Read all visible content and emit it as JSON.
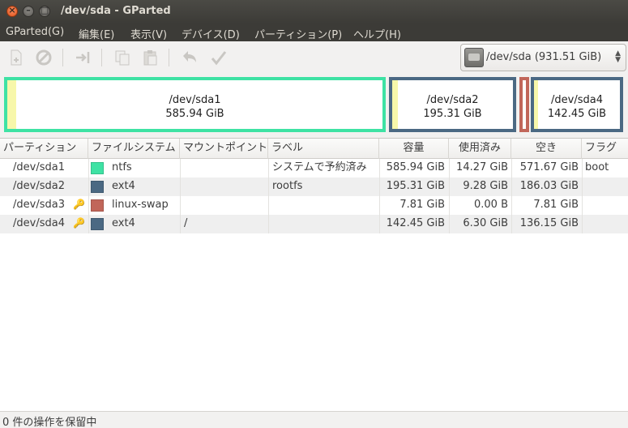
{
  "window": {
    "title": "/dev/sda - GParted"
  },
  "menu": [
    "GParted(G)",
    "編集(E)",
    "表示(V)",
    "デバイス(D)",
    "パーティション(P)",
    "ヘルプ(H)"
  ],
  "toolbar": {
    "buttons": [
      "new-icon",
      "delete-icon",
      "resize-move-icon",
      "copy-icon",
      "paste-icon",
      "undo-icon",
      "apply-icon"
    ],
    "device_selector": "/dev/sda  (931.51 GiB)"
  },
  "partition_map": [
    {
      "name": "/dev/sda1",
      "size": "585.94 GiB",
      "used_fraction": 0.024,
      "color": "#3ee2a4"
    },
    {
      "name": "/dev/sda2",
      "size": "195.31 GiB",
      "used_fraction": 0.048,
      "color": "#4b6983"
    },
    {
      "name": "/dev/sda3",
      "size": "",
      "used_fraction": 0,
      "color": "#c1665a"
    },
    {
      "name": "/dev/sda4",
      "size": "142.45 GiB",
      "used_fraction": 0.044,
      "color": "#4b6983"
    }
  ],
  "table": {
    "columns": [
      "パーティション",
      "ファイルシステム",
      "マウントポイント",
      "ラベル",
      "容量",
      "使用済み",
      "空き",
      "フラグ"
    ],
    "rows": [
      {
        "partition": "/dev/sda1",
        "fs": "ntfs",
        "fs_color": "#3ee2a4",
        "mount": "",
        "label": "システムで予約済み",
        "size": "585.94 GiB",
        "used": "14.27 GiB",
        "free": "571.67 GiB",
        "flags": "boot",
        "key_icon": false
      },
      {
        "partition": "/dev/sda2",
        "fs": "ext4",
        "fs_color": "#4b6983",
        "mount": "",
        "label": "rootfs",
        "size": "195.31 GiB",
        "used": "9.28 GiB",
        "free": "186.03 GiB",
        "flags": "",
        "key_icon": false
      },
      {
        "partition": "/dev/sda3",
        "fs": "linux-swap",
        "fs_color": "#c1665a",
        "mount": "",
        "label": "",
        "size": "7.81 GiB",
        "used": "0.00 B",
        "free": "7.81 GiB",
        "flags": "",
        "key_icon": true
      },
      {
        "partition": "/dev/sda4",
        "fs": "ext4",
        "fs_color": "#4b6983",
        "mount": "/",
        "label": "",
        "size": "142.45 GiB",
        "used": "6.30 GiB",
        "free": "136.15 GiB",
        "flags": "",
        "key_icon": true
      }
    ]
  },
  "status": {
    "text": "0 件の操作を保留中"
  }
}
